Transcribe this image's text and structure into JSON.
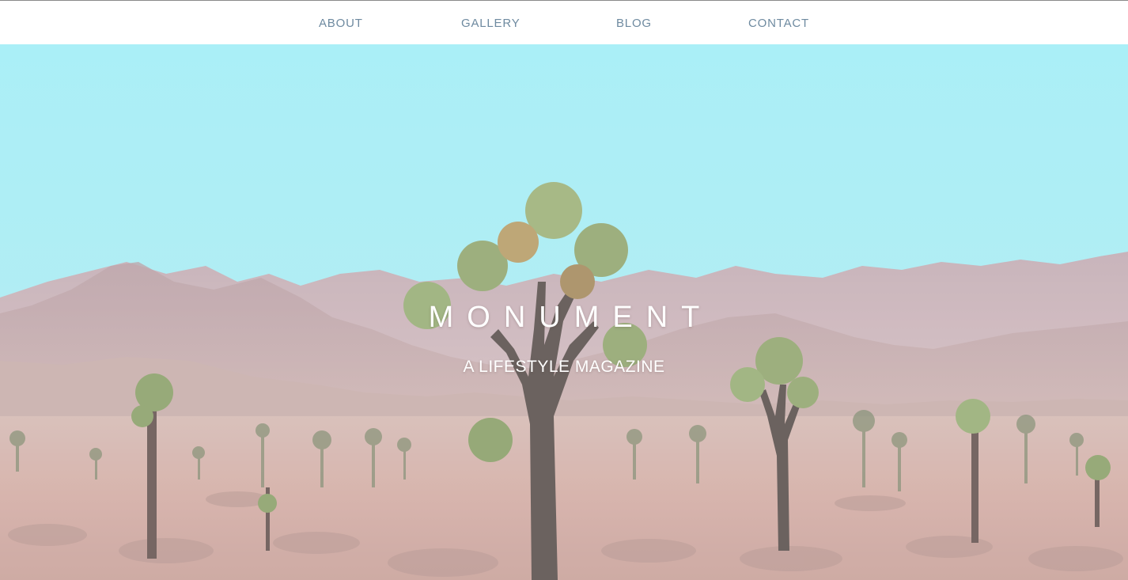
{
  "nav": {
    "items": [
      {
        "label": "ABOUT"
      },
      {
        "label": "GALLERY"
      },
      {
        "label": "BLOG"
      },
      {
        "label": "CONTACT"
      }
    ]
  },
  "hero": {
    "title": "MONUMENT",
    "subtitle": "A LIFESTYLE MAGAZINE",
    "image_subject": "desert-landscape-joshua-trees"
  },
  "colors": {
    "nav_text": "#6e8aa0",
    "sky": "#a6ecf4",
    "mountains": "#bfa6ab",
    "ground": "#d2b0aa",
    "hero_text": "#ffffff"
  }
}
